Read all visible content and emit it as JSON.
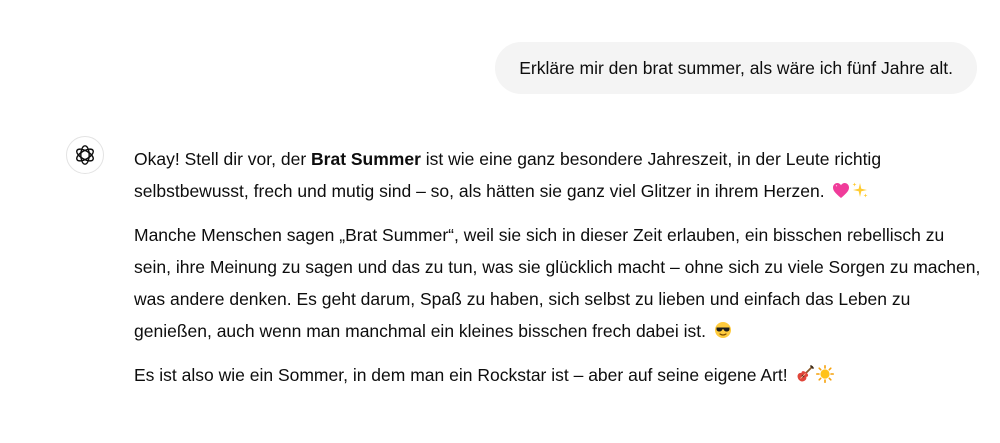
{
  "user_message": "Erkläre mir den brat summer, als wäre ich fünf Jahre alt.",
  "assistant": {
    "avatar_icon": "openai-logo-icon",
    "p1_a": "Okay! Stell dir vor, der ",
    "p1_bold": "Brat Summer",
    "p1_b": " ist wie eine ganz besondere Jahreszeit, in der Leute richtig selbstbewusst, frech und mutig sind – so, als hätten sie ganz viel Glitzer in ihrem Herzen.",
    "p1_emojis": [
      "heart-emoji",
      "sparkles-emoji"
    ],
    "p2": "Manche Menschen sagen „Brat Summer“, weil sie sich in dieser Zeit erlauben, ein bisschen rebellisch zu sein, ihre Meinung zu sagen und das zu tun, was sie glücklich macht – ohne sich zu viele Sorgen zu machen, was andere denken. Es geht darum, Spaß zu haben, sich selbst zu lieben und einfach das Leben zu genießen, auch wenn man manchmal ein kleines bisschen frech dabei ist.",
    "p2_emojis": [
      "sunglasses-emoji"
    ],
    "p3": "Es ist also wie ein Sommer, in dem man ein Rockstar ist – aber auf seine eigene Art!",
    "p3_emojis": [
      "guitar-emoji",
      "sun-emoji"
    ]
  }
}
